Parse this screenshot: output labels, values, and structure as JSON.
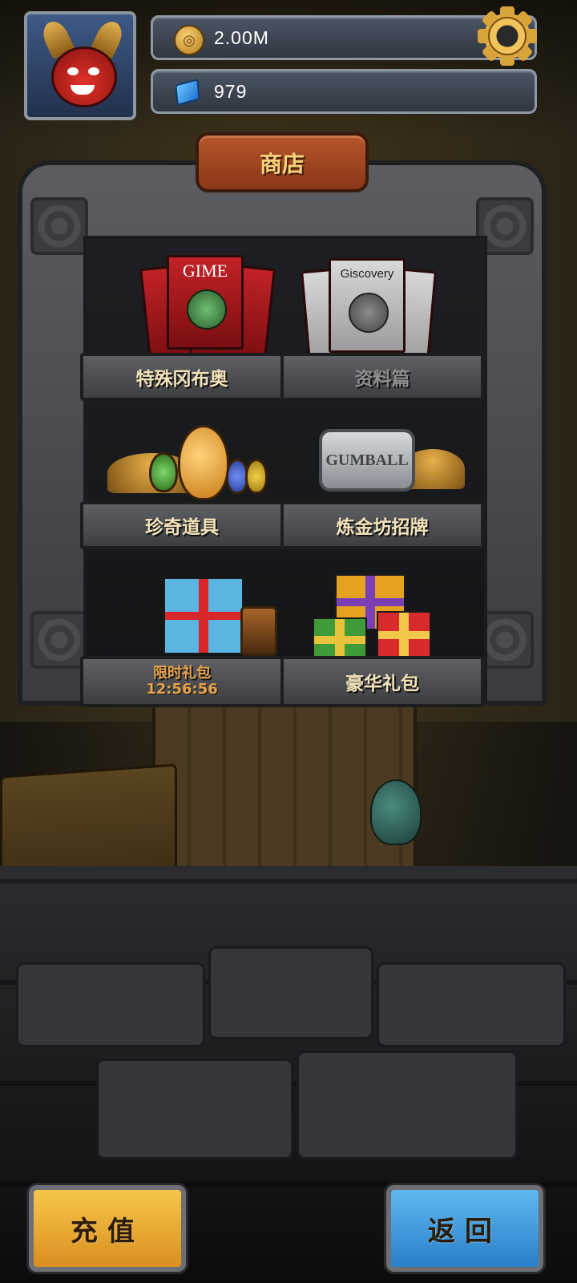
{
  "header": {
    "coins": "2.00M",
    "gems": "979"
  },
  "shop": {
    "title": "商店",
    "items": [
      {
        "label": "特殊冈布奥",
        "disabled": false
      },
      {
        "label": "资料篇",
        "disabled": true
      },
      {
        "label": "珍奇道具",
        "disabled": false
      },
      {
        "label": "炼金坊招牌",
        "disabled": false
      },
      {
        "label": "限时礼包",
        "timer": "12:56:56",
        "disabled": false
      },
      {
        "label": "豪华礼包",
        "disabled": false
      }
    ],
    "magazine_red_title": "GIME",
    "magazine_grey_title": "Giscovery",
    "plaque_text": "GUMBALL"
  },
  "buttons": {
    "topup": "充值",
    "back": "返回"
  },
  "colors": {
    "accent_gold": "#f6c64b",
    "accent_blue": "#2a7fc9",
    "label_text": "#f1e2b9",
    "timer_text": "#e8a44a"
  },
  "icons": {
    "coin": "coin-icon",
    "gem": "gem-icon",
    "settings": "gear-icon"
  }
}
